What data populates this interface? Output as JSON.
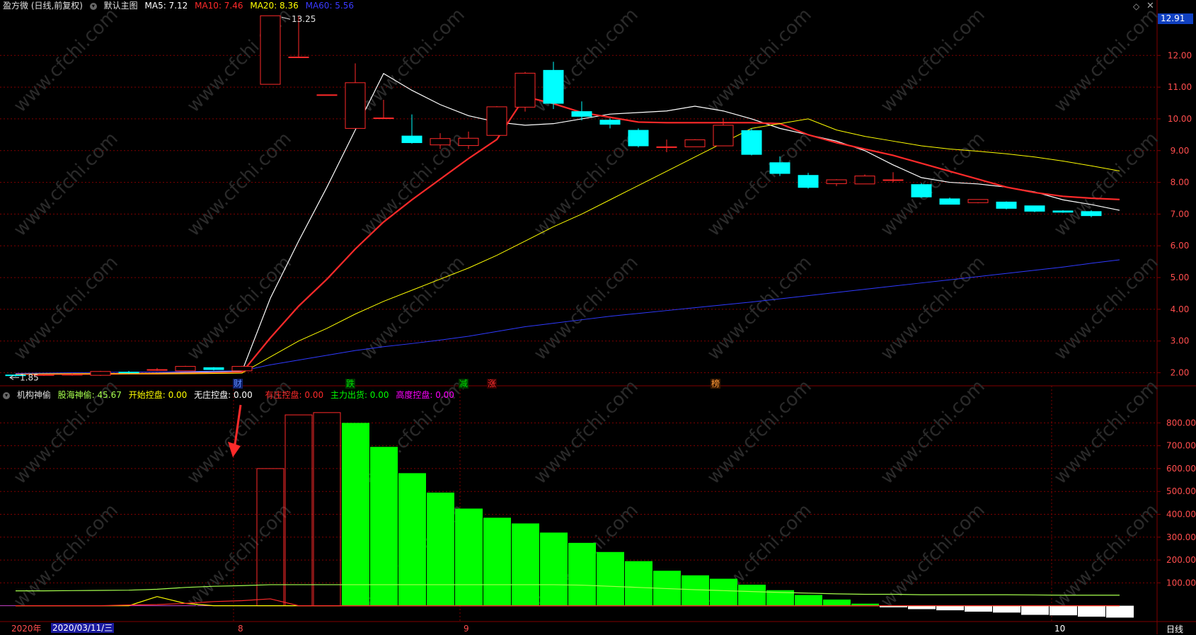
{
  "header": {
    "title": "盈方微 (日线,前复权)",
    "main_name": "默认主图",
    "ma": [
      {
        "label": "MA5: 7.12",
        "color": "#ffffff"
      },
      {
        "label": "MA10: 7.46",
        "color": "#ff2a2a"
      },
      {
        "label": "MA20: 8.36",
        "color": "#ffff00"
      },
      {
        "label": "MA60: 5.56",
        "color": "#3333ff"
      }
    ]
  },
  "sub_header": {
    "name": "机构神偷",
    "items": [
      {
        "label": "股海神偷: 45.67",
        "color": "#a6ff4d"
      },
      {
        "label": "开始控盘: 0.00",
        "color": "#ffff00"
      },
      {
        "label": "无庄控盘: 0.00",
        "color": "#ffffff"
      },
      {
        "label": "有庄控盘: 0.00",
        "color": "#ff2a2a"
      },
      {
        "label": "主力出货: 0.00",
        "color": "#00ff00"
      },
      {
        "label": "高度控盘: 0.00",
        "color": "#ff00ff"
      }
    ]
  },
  "price_badge": "12.91",
  "icons": {
    "diamond": "diamond-icon",
    "close": "close-icon"
  },
  "x_axis": {
    "year_label": "2020年",
    "date_box": "2020/03/11/三",
    "month_labels": [
      {
        "label": "8",
        "color": "#ff4d4d"
      },
      {
        "label": "9",
        "color": "#ff4d4d"
      },
      {
        "label": "10",
        "color": "#ffffff"
      }
    ],
    "period": "日线"
  },
  "main_axis": {
    "ticks": [
      "12.00",
      "11.00",
      "10.00",
      "9.00",
      "8.00",
      "7.00",
      "6.00",
      "5.00",
      "4.00",
      "3.00",
      "2.00"
    ]
  },
  "sub_axis": {
    "ticks": [
      "800.00",
      "700.00",
      "600.00",
      "500.00",
      "400.00",
      "300.00",
      "200.00",
      "100.00"
    ]
  },
  "annotations": {
    "high": "13.25",
    "low": "1.85",
    "events": [
      {
        "label": "财",
        "color": "#5b8bff",
        "bg": "#10206a"
      },
      {
        "label": "跌",
        "color": "#00e000",
        "bg": "#003300"
      },
      {
        "label": "减",
        "color": "#00e000",
        "bg": "#003300"
      },
      {
        "label": "涨",
        "color": "#ff3030",
        "bg": "#330000"
      },
      {
        "label": "榜",
        "color": "#ff9a3a",
        "bg": "#3a1a00"
      }
    ]
  },
  "colors": {
    "up": "#ff2a2a",
    "down": "#00ffff",
    "grid": "#800000",
    "axis": "#800000"
  },
  "chart_data": [
    {
      "type": "candlestick",
      "title": "盈方微 (日线,前复权)",
      "ylim": [
        1.7,
        13.3
      ],
      "candles": [
        {
          "o": 1.93,
          "c": 1.91,
          "h": 1.95,
          "l": 1.88
        },
        {
          "o": 1.92,
          "c": 1.94,
          "h": 1.96,
          "l": 1.9
        },
        {
          "o": 1.93,
          "c": 1.95,
          "h": 1.98,
          "l": 1.91
        },
        {
          "o": 1.92,
          "c": 2.04,
          "h": 2.06,
          "l": 1.9
        },
        {
          "o": 2.02,
          "c": 2.0,
          "h": 2.06,
          "l": 1.98
        },
        {
          "o": 2.09,
          "c": 2.1,
          "h": 2.15,
          "l": 2.06
        },
        {
          "o": 2.06,
          "c": 2.2,
          "h": 2.22,
          "l": 2.05
        },
        {
          "o": 2.16,
          "c": 2.1,
          "h": 2.18,
          "l": 2.07
        },
        {
          "o": 2.06,
          "c": 2.2,
          "h": 2.22,
          "l": 2.04
        },
        {
          "o": 11.09,
          "c": 13.25,
          "h": 13.25,
          "l": 11.09
        },
        {
          "o": 11.95,
          "c": 11.95,
          "h": 13.25,
          "l": 11.95
        },
        {
          "o": 10.76,
          "c": 10.76,
          "h": 10.76,
          "l": 10.76
        },
        {
          "o": 9.7,
          "c": 11.14,
          "h": 11.75,
          "l": 9.7
        },
        {
          "o": 10.03,
          "c": 10.03,
          "h": 10.6,
          "l": 10.03
        },
        {
          "o": 9.46,
          "c": 9.25,
          "h": 10.14,
          "l": 9.22
        },
        {
          "o": 9.18,
          "c": 9.38,
          "h": 9.55,
          "l": 9.05
        },
        {
          "o": 9.16,
          "c": 9.39,
          "h": 9.6,
          "l": 9.05
        },
        {
          "o": 9.48,
          "c": 10.38,
          "h": 10.4,
          "l": 9.48
        },
        {
          "o": 10.37,
          "c": 11.44,
          "h": 11.48,
          "l": 10.23
        },
        {
          "o": 11.53,
          "c": 10.49,
          "h": 11.8,
          "l": 10.31
        },
        {
          "o": 10.23,
          "c": 10.08,
          "h": 10.55,
          "l": 9.95
        },
        {
          "o": 9.96,
          "c": 9.83,
          "h": 10.02,
          "l": 9.7
        },
        {
          "o": 9.64,
          "c": 9.15,
          "h": 9.7,
          "l": 9.1
        },
        {
          "o": 9.12,
          "c": 9.12,
          "h": 9.35,
          "l": 8.95
        },
        {
          "o": 9.12,
          "c": 9.34,
          "h": 9.36,
          "l": 9.12
        },
        {
          "o": 9.15,
          "c": 9.8,
          "h": 10.02,
          "l": 9.15
        },
        {
          "o": 9.63,
          "c": 8.88,
          "h": 9.7,
          "l": 8.85
        },
        {
          "o": 8.62,
          "c": 8.28,
          "h": 8.82,
          "l": 8.2
        },
        {
          "o": 8.22,
          "c": 7.84,
          "h": 8.3,
          "l": 7.8
        },
        {
          "o": 7.96,
          "c": 8.08,
          "h": 8.1,
          "l": 7.88
        },
        {
          "o": 7.95,
          "c": 8.2,
          "h": 8.25,
          "l": 7.95
        },
        {
          "o": 8.08,
          "c": 8.08,
          "h": 8.32,
          "l": 8.0
        },
        {
          "o": 7.93,
          "c": 7.54,
          "h": 7.98,
          "l": 7.51
        },
        {
          "o": 7.48,
          "c": 7.31,
          "h": 7.52,
          "l": 7.3
        },
        {
          "o": 7.36,
          "c": 7.46,
          "h": 7.46,
          "l": 7.34
        },
        {
          "o": 7.38,
          "c": 7.18,
          "h": 7.4,
          "l": 7.15
        },
        {
          "o": 7.26,
          "c": 7.09,
          "h": 7.26,
          "l": 7.06
        },
        {
          "o": 7.1,
          "c": 7.06,
          "h": 7.12,
          "l": 7.04
        },
        {
          "o": 7.08,
          "c": 6.95,
          "h": 7.12,
          "l": 6.9
        }
      ],
      "series": [
        {
          "name": "MA5",
          "color": "#ffffff",
          "width": 1.2,
          "values": [
            1.96,
            1.96,
            1.96,
            1.97,
            1.98,
            1.99,
            2.01,
            2.03,
            2.05,
            4.35,
            6.15,
            7.85,
            9.65,
            11.43,
            10.9,
            10.45,
            10.1,
            9.9,
            9.8,
            9.85,
            10.0,
            10.15,
            10.2,
            10.25,
            10.4,
            10.25,
            10.0,
            9.7,
            9.5,
            9.3,
            9.0,
            8.55,
            8.15,
            8.0,
            7.95,
            7.85,
            7.7,
            7.45,
            7.3,
            7.12
          ]
        },
        {
          "name": "MA10",
          "color": "#ff2a2a",
          "width": 2.2,
          "values": [
            1.96,
            1.96,
            1.96,
            1.96,
            1.97,
            1.97,
            1.98,
            1.99,
            2.01,
            3.1,
            4.1,
            4.95,
            5.9,
            6.75,
            7.45,
            8.1,
            8.75,
            9.35,
            10.7,
            10.48,
            10.2,
            10.05,
            9.9,
            9.88,
            9.88,
            9.88,
            9.88,
            9.85,
            9.5,
            9.25,
            9.05,
            8.85,
            8.6,
            8.35,
            8.1,
            7.85,
            7.68,
            7.56,
            7.5,
            7.46
          ]
        },
        {
          "name": "MA20",
          "color": "#ffff00",
          "width": 1,
          "values": [
            1.97,
            1.97,
            1.97,
            1.97,
            1.97,
            1.97,
            1.97,
            1.98,
            1.99,
            2.5,
            3.0,
            3.4,
            3.85,
            4.25,
            4.6,
            4.95,
            5.3,
            5.7,
            6.15,
            6.6,
            7.0,
            7.45,
            7.9,
            8.35,
            8.8,
            9.25,
            9.7,
            9.85,
            10.0,
            9.65,
            9.45,
            9.3,
            9.15,
            9.05,
            8.98,
            8.9,
            8.8,
            8.67,
            8.52,
            8.36
          ]
        },
        {
          "name": "MA60",
          "color": "#2f3aff",
          "width": 1,
          "values": [
            1.98,
            1.99,
            2.0,
            2.01,
            2.02,
            2.03,
            2.04,
            2.05,
            2.06,
            2.25,
            2.4,
            2.55,
            2.7,
            2.82,
            2.92,
            3.03,
            3.15,
            3.3,
            3.45,
            3.56,
            3.67,
            3.78,
            3.87,
            3.96,
            4.05,
            4.14,
            4.23,
            4.33,
            4.43,
            4.53,
            4.63,
            4.73,
            4.83,
            4.93,
            5.03,
            5.13,
            5.23,
            5.33,
            5.45,
            5.56
          ]
        }
      ]
    },
    {
      "type": "bar",
      "title": "机构神偷",
      "ylim": [
        -60,
        860
      ],
      "values": [
        0,
        0,
        0,
        0,
        0,
        0,
        0,
        0,
        0,
        600,
        835,
        845,
        800,
        695,
        580,
        495,
        425,
        385,
        360,
        320,
        275,
        235,
        195,
        153,
        133,
        118,
        92,
        68,
        47,
        27,
        9,
        -7,
        -15,
        -20,
        -26,
        -30,
        -40,
        -42,
        -48,
        -52
      ],
      "bar_style": [
        "none",
        "none",
        "none",
        "none",
        "none",
        "none",
        "none",
        "none",
        "none",
        "hollow-red",
        "hollow-red",
        "hollow-red",
        "green",
        "green",
        "green",
        "green",
        "green",
        "green",
        "green",
        "green",
        "green",
        "green",
        "green",
        "green",
        "green",
        "green",
        "green",
        "green",
        "green",
        "green",
        "green",
        "white",
        "white",
        "white",
        "white",
        "white",
        "white",
        "white",
        "white",
        "white"
      ],
      "series": [
        {
          "name": "股海神偷",
          "color": "#a6ff4d",
          "values": [
            65,
            65,
            66,
            67,
            68,
            72,
            80,
            85,
            88,
            92,
            92,
            92,
            92,
            92,
            92,
            92,
            92,
            92,
            92,
            92,
            90,
            85,
            80,
            75,
            70,
            66,
            62,
            58,
            55,
            52,
            50,
            50,
            48,
            48,
            48,
            48,
            47,
            46,
            46,
            46
          ]
        },
        {
          "name": "开始控盘",
          "color": "#ffff00",
          "values": [
            0,
            0,
            0,
            0,
            0,
            40,
            10,
            0,
            0,
            0,
            0,
            0,
            0,
            0,
            0,
            0,
            0,
            0,
            0,
            0,
            0,
            0,
            0,
            0,
            0,
            0,
            0,
            0,
            0,
            0,
            0,
            0,
            0,
            0,
            0,
            0,
            0,
            0,
            0,
            0
          ]
        },
        {
          "name": "有庄控盘",
          "color": "#ff2a2a",
          "values": [
            0,
            0,
            0,
            0,
            3,
            5,
            10,
            18,
            22,
            30,
            0,
            0,
            0,
            0,
            0,
            0,
            0,
            0,
            0,
            0,
            0,
            0,
            0,
            0,
            0,
            0,
            0,
            0,
            0,
            0,
            0,
            0,
            0,
            0,
            0,
            0,
            0,
            0,
            0,
            0
          ]
        }
      ]
    }
  ]
}
